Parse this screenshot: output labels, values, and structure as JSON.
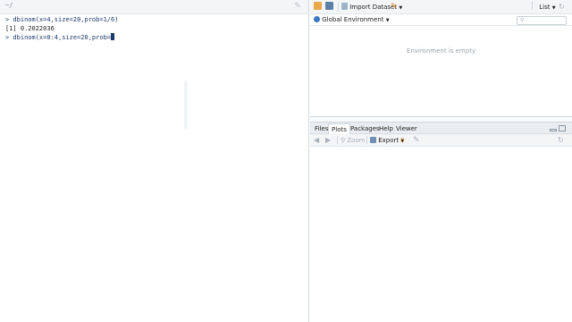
{
  "console": {
    "path": "~/",
    "lines": [
      {
        "prompt": ">",
        "text": " dbinom(x=4,size=20,prob=1/6)"
      },
      {
        "prompt": "",
        "text": "[1] 0.2022036"
      },
      {
        "prompt": ">",
        "text": " dbinom(x=0:4,size=20,prob="
      }
    ]
  },
  "environment": {
    "toolbar": {
      "import_dataset": "Import Dataset",
      "view_mode": "List"
    },
    "scope": "Global Environment",
    "empty_message": "Environment is empty"
  },
  "files_pane": {
    "tabs": [
      "Files",
      "Plots",
      "Packages",
      "Help",
      "Viewer"
    ],
    "active_tab": "Plots",
    "toolbar": {
      "zoom": "Zoom",
      "export": "Export",
      "remove_count": "0"
    }
  },
  "colors": {
    "accent_orange": "#e38b2c",
    "prompt_blue": "#1b3a6b"
  }
}
